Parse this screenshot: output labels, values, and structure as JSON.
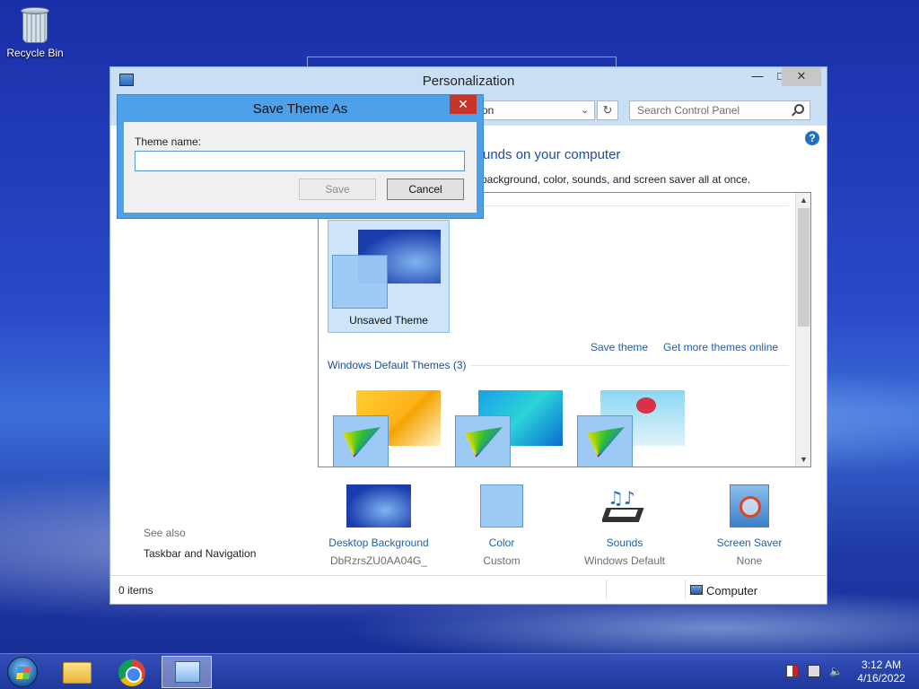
{
  "desktop": {
    "recycle_bin_label": "Recycle Bin"
  },
  "window": {
    "title": "Personalization",
    "address_text": "on",
    "search_placeholder": "Search Control Panel",
    "heading": "unds on your computer",
    "subheading": "p background, color, sounds, and screen saver all at once.",
    "unsaved_theme_label": "Unsaved Theme",
    "save_theme_link": "Save theme",
    "get_more_link": "Get more themes online",
    "default_group_header": "Windows Default Themes (3)",
    "see_also": "See also",
    "taskbar_nav_link": "Taskbar and Navigation",
    "bottom_items": [
      {
        "label": "Desktop Background",
        "sub": "DbRzrsZU0AA04G_",
        "icon": "desktop-background-icon"
      },
      {
        "label": "Color",
        "sub": "Custom",
        "icon": "color-icon"
      },
      {
        "label": "Sounds",
        "sub": "Windows Default",
        "icon": "sounds-icon"
      },
      {
        "label": "Screen Saver",
        "sub": "None",
        "icon": "screen-saver-icon"
      }
    ],
    "status_items": "0 items",
    "status_computer": "Computer"
  },
  "dialog": {
    "title": "Save Theme As",
    "field_label": "Theme name:",
    "field_value": "",
    "save_button": "Save",
    "cancel_button": "Cancel",
    "close_glyph": "✕"
  },
  "taskbar": {
    "time": "3:12 AM",
    "date": "4/16/2022"
  },
  "colors": {
    "link": "#1b5fb3",
    "dialog_frame": "#4ea1e8",
    "close_red": "#c7342a"
  }
}
